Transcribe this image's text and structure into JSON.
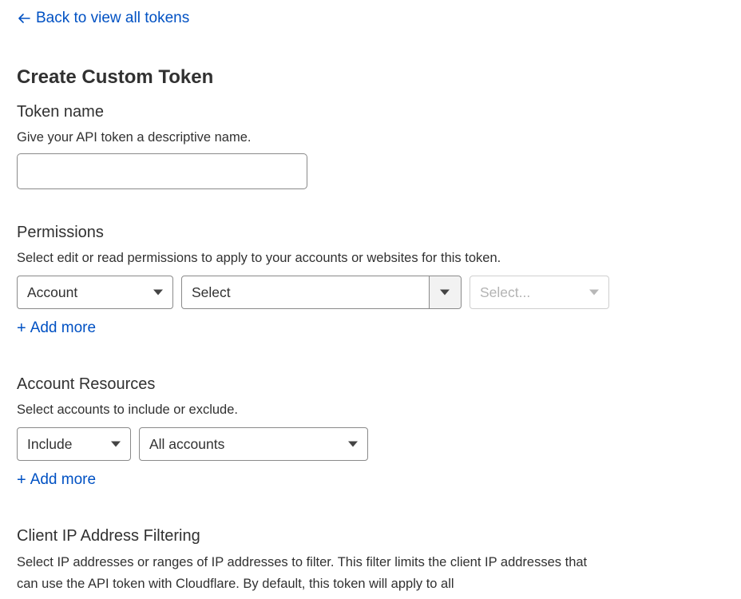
{
  "back_link": {
    "label": "Back to view all tokens"
  },
  "page_title": "Create Custom Token",
  "token_name": {
    "title": "Token name",
    "description": "Give your API token a descriptive name.",
    "value": "",
    "placeholder": ""
  },
  "permissions": {
    "title": "Permissions",
    "description": "Select edit or read permissions to apply to your accounts or websites for this token.",
    "scope_value": "Account",
    "resource_value": "Select",
    "access_placeholder": "Select...",
    "add_more": "Add more"
  },
  "account_resources": {
    "title": "Account Resources",
    "description": "Select accounts to include or exclude.",
    "mode_value": "Include",
    "accounts_value": "All accounts",
    "add_more": "Add more"
  },
  "ip_filtering": {
    "title": "Client IP Address Filtering",
    "description": "Select IP addresses or ranges of IP addresses to filter. This filter limits the client IP addresses that can use the API token with Cloudflare. By default, this token will apply to all"
  },
  "colors": {
    "link": "#0051c3",
    "text": "#313131",
    "border": "#8a8a8a"
  }
}
